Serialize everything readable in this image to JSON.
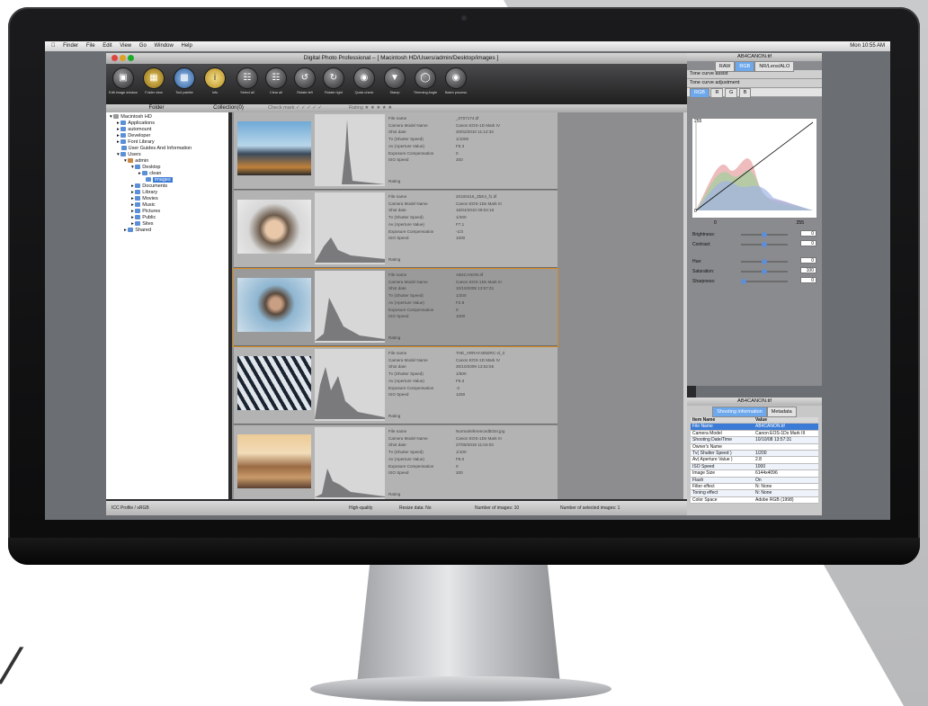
{
  "menubar": {
    "items": [
      "Finder",
      "File",
      "Edit",
      "View",
      "Go",
      "Window",
      "Help"
    ],
    "clock": "Mon 10:55 AM"
  },
  "window": {
    "title": "Digital Photo Professional – [ Macintosh HD/Users/admin/Desktop/images ]"
  },
  "toolbar": {
    "buttons": [
      {
        "label": "Edit image window",
        "icon": "edit-image-icon"
      },
      {
        "label": "Folder view",
        "icon": "folder-view-icon"
      },
      {
        "label": "Tool palette",
        "icon": "tool-palette-icon"
      },
      {
        "label": "Info",
        "icon": "info-icon"
      },
      {
        "label": "Select all",
        "icon": "select-all-icon"
      },
      {
        "label": "Clear all",
        "icon": "clear-all-icon"
      },
      {
        "label": "Rotate left",
        "icon": "rotate-left-icon"
      },
      {
        "label": "Rotate right",
        "icon": "rotate-right-icon"
      },
      {
        "label": "Quick check",
        "icon": "quick-check-icon"
      },
      {
        "label": "Stamp",
        "icon": "stamp-icon"
      },
      {
        "label": "Trimming Angle",
        "icon": "trimming-icon"
      },
      {
        "label": "Batch process",
        "icon": "batch-process-icon"
      }
    ]
  },
  "tabs": {
    "folder": "Folder",
    "collection": "Collection(0)",
    "checkmark": "Check mark",
    "rating": "Rating"
  },
  "tree": {
    "nodes": [
      {
        "label": "Macintosh HD",
        "level": 0
      },
      {
        "label": "Applications",
        "level": 1
      },
      {
        "label": "automount",
        "level": 1
      },
      {
        "label": "Developer",
        "level": 1
      },
      {
        "label": "Font Library",
        "level": 1
      },
      {
        "label": "User Guides And Information",
        "level": 1
      },
      {
        "label": "Users",
        "level": 1
      },
      {
        "label": "admin",
        "level": 2
      },
      {
        "label": "Desktop",
        "level": 3
      },
      {
        "label": "clean",
        "level": 4
      },
      {
        "label": "images",
        "level": 4,
        "selected": true
      },
      {
        "label": "Documents",
        "level": 3
      },
      {
        "label": "Library",
        "level": 3
      },
      {
        "label": "Movies",
        "level": 3
      },
      {
        "label": "Music",
        "level": 3
      },
      {
        "label": "Pictures",
        "level": 3
      },
      {
        "label": "Public",
        "level": 3
      },
      {
        "label": "Sites",
        "level": 3
      },
      {
        "label": "Shared",
        "level": 2
      }
    ]
  },
  "meta_labels": [
    "File name",
    "Camera Model Name",
    "Shot date",
    "Tv (Shutter Speed)",
    "Av (Aperture Value)",
    "Exposure Compensation",
    "ISO Speed"
  ],
  "rating_label": "Rating",
  "images": [
    {
      "values": [
        "_0707174.tif",
        "Canon EOS-1D Mark IV",
        "20/02/2010 11:12:33",
        "1/1000",
        "F6.3",
        "0",
        "200"
      ]
    },
    {
      "values": [
        "20100416_ZbE4_f1.tif",
        "Canon EOS-1Ds Mark III",
        "16/04/2010 09:04:16",
        "1/400",
        "F7.1",
        "-1/3",
        "1000"
      ]
    },
    {
      "values": [
        "AB4CANON.tif",
        "Canon EOS-1Ds Mark III",
        "10/10/2008 13:57:31",
        "1/200",
        "F2.8",
        "0",
        "1000"
      ]
    },
    {
      "values": [
        "THE_ARRAY4050RC-vl_3",
        "Canon EOS-1D Mark IV",
        "30/10/2009 13:52:55",
        "1/500",
        "F6.3",
        "-2",
        "1250"
      ]
    },
    {
      "values": [
        "Normalreferencedb034.jpg",
        "Canon EOS-1Ds Mark III",
        "27/05/2019 11:04:03",
        "1/100",
        "F8.0",
        "0",
        "200"
      ]
    }
  ],
  "status": {
    "profile": "ICC Profile / sRGB",
    "quality": "High-quality",
    "resize": "Resize data: No",
    "count": "Number of images: 10",
    "selected": "Number of selected images: 1"
  },
  "tool_palette": {
    "title": "AB4CANON.tif",
    "tabs": [
      "RAW",
      "RGB",
      "NR/Lens/ALO"
    ],
    "rows": [
      "Tone curve assist",
      "Tone curve adjustment"
    ],
    "channels": [
      "RGB",
      "R",
      "G",
      "B"
    ],
    "curve_max": "255",
    "curve_min": "0",
    "curve_right": "255",
    "sliders": [
      {
        "label": "Brightness:",
        "value": "0"
      },
      {
        "label": "Contrast:",
        "value": "0"
      },
      {
        "label": "Hue:",
        "value": "0"
      },
      {
        "label": "Saturation:",
        "value": "100"
      },
      {
        "label": "Sharpness:",
        "value": "0"
      }
    ]
  },
  "info_palette": {
    "title": "AB4CANON.tif",
    "tabs": [
      "Shooting information",
      "Metadata"
    ],
    "header": [
      "Item Name",
      "Value"
    ],
    "rows": [
      [
        "File Name",
        "AB4CANON.tif"
      ],
      [
        "Camera Model",
        "Canon EOS-1Ds Mark III"
      ],
      [
        "Shooting Date/Time",
        "10/10/08 13:57:31"
      ],
      [
        "Owner's Name",
        ""
      ],
      [
        "Tv( Shutter Speed )",
        "1/200"
      ],
      [
        "Av( Aperture Value )",
        "2.8"
      ],
      [
        "ISO Speed",
        "1000"
      ],
      [
        "Image Size",
        "6144x4096"
      ],
      [
        "Flash",
        "On"
      ],
      [
        "Filter effect",
        "N: None"
      ],
      [
        "Toning effect",
        "N: None"
      ],
      [
        "Color Space",
        "Adobe RGB (1998)"
      ]
    ]
  }
}
